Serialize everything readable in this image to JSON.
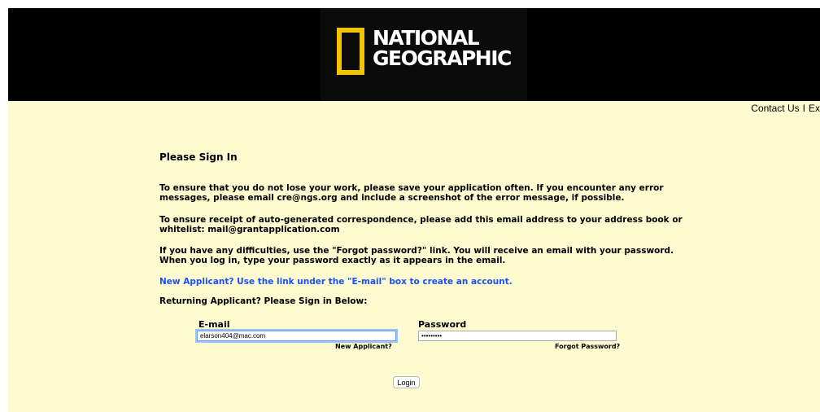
{
  "header": {
    "logo_line1": "NATIONAL",
    "logo_line2": "GEOGRAPHIC",
    "logo_color": "#f2c400"
  },
  "toplinks": {
    "contact": "Contact Us",
    "separator": "I",
    "exit": "Ex"
  },
  "page": {
    "title": "Please Sign In",
    "para1": "To ensure that you do not lose your work, please save your application often. If you encounter any error messages, please email cre@ngs.org and include a screenshot of the error message, if possible.",
    "para2": "To ensure receipt of auto-generated correspondence, please add this email address to your address book or whitelist: mail@grantapplication.com",
    "para3": "If you have any difficulties, use the \"Forgot password?\" link. You will receive an email with your password. When you log in, type your password exactly as it appears in the email.",
    "new_applicant_note": "New Applicant? Use the link under the \"E-mail\" box to create an account.",
    "returning": "Returning Applicant? Please Sign in Below:"
  },
  "form": {
    "email_label": "E-mail",
    "email_value": "elarson404@mac.com",
    "password_label": "Password",
    "password_value": "•••••••••",
    "new_applicant_link": "New Applicant?",
    "forgot_link": "Forgot Password?",
    "login_button": "Login"
  },
  "colors": {
    "background": "#fffbd0",
    "header": "#000000",
    "link_blue": "#1a4fff"
  }
}
